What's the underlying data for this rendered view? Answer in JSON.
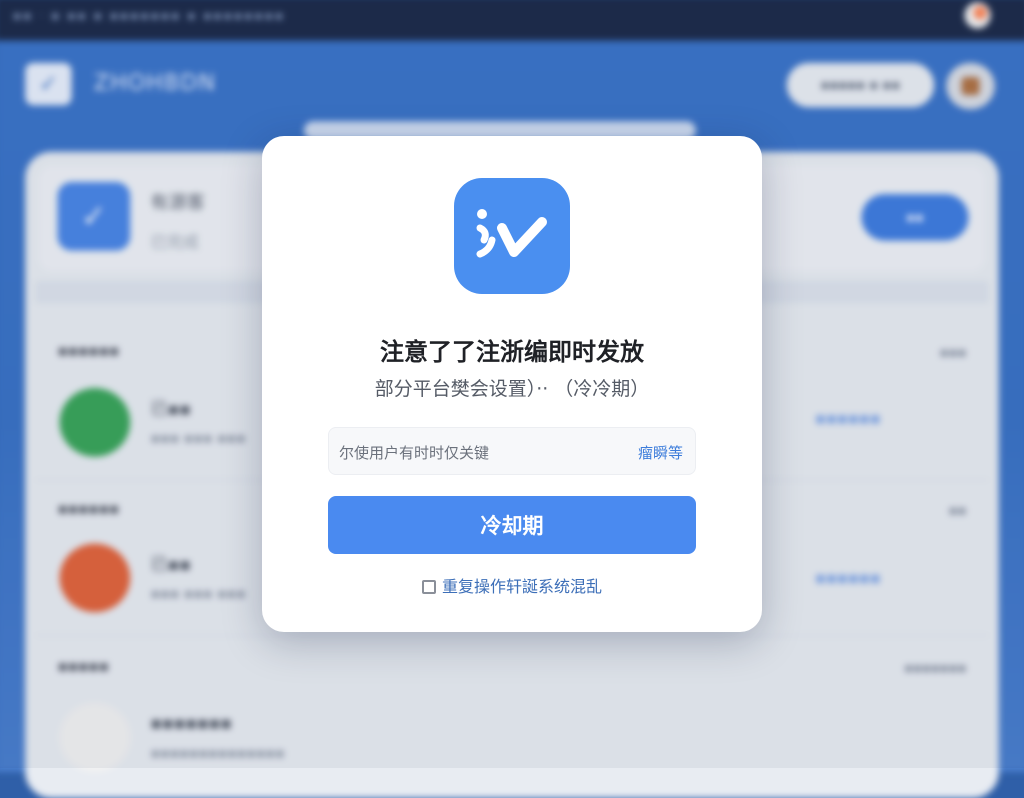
{
  "background": {
    "topbar_text": "▪▪ · ▪ ▪▪ ▪ ▪▪▪▪▪▪▪ ▪ ▪▪▪▪▪▪▪▪",
    "app_title": "ZHOHBDN",
    "header_pill": "▪▪▪▪▪ ▪ ▪▪",
    "profile": {
      "name": "有源客",
      "sub": "已完成",
      "button": "▪▪"
    },
    "sections": [
      {
        "title": "▪▪▪▪▪▪",
        "more": "▪▪▪",
        "item_title": "已▪▪",
        "item_sub": "▪▪▪ ▪▪▪ ▪▪▪",
        "item_link": "▪▪▪▪▪▪",
        "icon_color": "#3aa55a"
      },
      {
        "title": "▪▪▪▪▪▪",
        "more": "▪▪",
        "item_title": "已▪▪",
        "item_sub": "▪▪▪ ▪▪▪ ▪▪▪",
        "item_link": "▪▪▪▪▪▪",
        "icon_color": "#e2643c"
      },
      {
        "title": "▪▪▪▪▪",
        "more": "▪▪▪▪▪▪▪",
        "item_title": "▪▪▪▪▪▪▪",
        "item_sub": "▪▪▪▪▪▪▪▪▪▪▪▪▪▪",
        "item_link": "",
        "icon_color": "#f2f2f2"
      }
    ]
  },
  "modal": {
    "logo_icon": "app-logo-icon",
    "title": "注意了了注浙编即时发放",
    "subtitle": "部分平台樊会设置）·· （冷冷期）",
    "notice_text": "尔使用户有时时仅关键",
    "notice_link": "瘤瞬等",
    "primary_button": "冷却期",
    "secondary_link": "重复操作轩誕系统混乱"
  },
  "colors": {
    "accent": "#4a8af0",
    "logo_bg": "#4a8ff0",
    "link": "#3d6fb8",
    "background_blue": "#3a72c5"
  }
}
